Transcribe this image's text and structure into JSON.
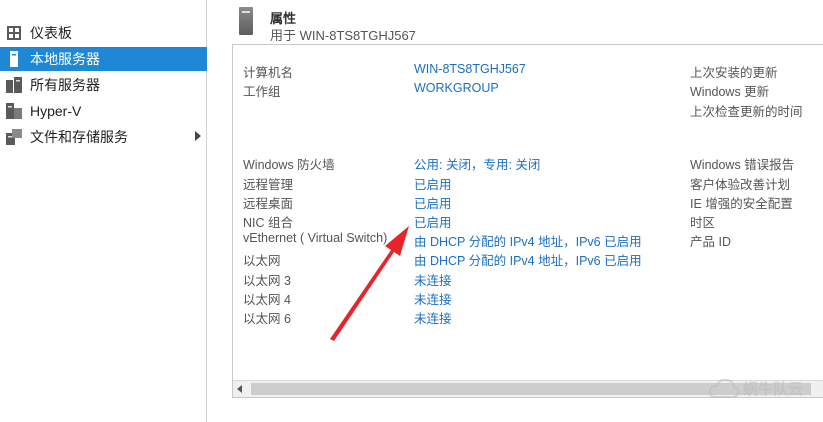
{
  "sidebar": {
    "items": [
      {
        "label": "仪表板",
        "icon": "dashboard-icon"
      },
      {
        "label": "本地服务器",
        "icon": "server-icon",
        "active": true
      },
      {
        "label": "所有服务器",
        "icon": "servers-icon"
      },
      {
        "label": "Hyper-V",
        "icon": "hyperv-icon"
      },
      {
        "label": "文件和存储服务",
        "icon": "storage-icon",
        "expandable": true
      }
    ]
  },
  "header": {
    "title": "属性",
    "subtitle": "用于 WIN-8TS8TGHJ567"
  },
  "properties": {
    "left": [
      {
        "label": "计算机名",
        "value": "WIN-8TS8TGHJ567"
      },
      {
        "label": "工作组",
        "value": "WORKGROUP"
      },
      {
        "label": "Windows 防火墙",
        "value": "公用: 关闭，专用: 关闭"
      },
      {
        "label": "远程管理",
        "value": "已启用"
      },
      {
        "label": "远程桌面",
        "value": "已启用"
      },
      {
        "label": "NIC 组合",
        "value": "已启用"
      },
      {
        "label": "vEthernet ( Virtual Switch)",
        "value": "由 DHCP 分配的 IPv4 地址，IPv6 已启用"
      },
      {
        "label": "以太网",
        "value": "由 DHCP 分配的 IPv4 地址，IPv6 已启用"
      },
      {
        "label": "以太网 3",
        "value": "未连接"
      },
      {
        "label": "以太网 4",
        "value": "未连接"
      },
      {
        "label": "以太网 6",
        "value": "未连接"
      }
    ],
    "right": [
      "上次安装的更新",
      "Windows 更新",
      "上次检查更新的时间",
      "Windows 错误报告",
      "客户体验改善计划",
      "IE 增强的安全配置",
      "时区",
      "产品 ID"
    ]
  },
  "watermark": "蜗牛队云",
  "colors": {
    "accent": "#1e88d6",
    "link": "#1a6fc4",
    "annotation": "#e8242a"
  }
}
